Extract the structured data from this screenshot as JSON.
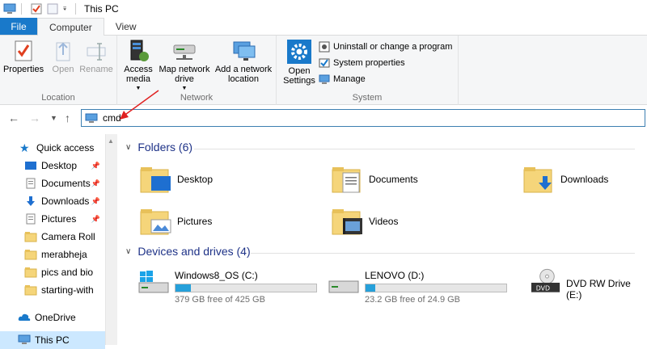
{
  "window": {
    "title": "This PC"
  },
  "tabs": {
    "file": "File",
    "computer": "Computer",
    "view": "View"
  },
  "ribbon": {
    "location": {
      "label": "Location",
      "properties": "Properties",
      "open": "Open",
      "rename": "Rename"
    },
    "network": {
      "label": "Network",
      "access_media": "Access media",
      "map_network_drive": "Map network drive",
      "add_network_location": "Add a network location"
    },
    "system": {
      "label": "System",
      "open_settings": "Open Settings",
      "uninstall": "Uninstall or change a program",
      "system_properties": "System properties",
      "manage": "Manage"
    }
  },
  "address": {
    "value": "cmd"
  },
  "nav": {
    "quick_access": "Quick access",
    "items": [
      {
        "label": "Desktop",
        "pinned": true
      },
      {
        "label": "Documents",
        "pinned": true
      },
      {
        "label": "Downloads",
        "pinned": true
      },
      {
        "label": "Pictures",
        "pinned": true
      },
      {
        "label": "Camera Roll",
        "pinned": false
      },
      {
        "label": "merabheja",
        "pinned": false
      },
      {
        "label": "pics and bio",
        "pinned": false
      },
      {
        "label": "starting-with",
        "pinned": false
      }
    ],
    "onedrive": "OneDrive",
    "this_pc": "This PC"
  },
  "content": {
    "folders_header": "Folders (6)",
    "folders": [
      "Desktop",
      "Documents",
      "Downloads",
      "Pictures",
      "Videos"
    ],
    "drives_header": "Devices and drives (4)",
    "drives": [
      {
        "name": "Windows8_OS (C:)",
        "free": "379 GB free of 425 GB",
        "used_fraction": 0.11
      },
      {
        "name": "LENOVO (D:)",
        "free": "23.2 GB free of 24.9 GB",
        "used_fraction": 0.07
      },
      {
        "name": "DVD RW Drive (E:)"
      }
    ]
  },
  "colors": {
    "file_tab": "#1979ca",
    "accent": "#26a0da",
    "header_text": "#1e3287"
  }
}
